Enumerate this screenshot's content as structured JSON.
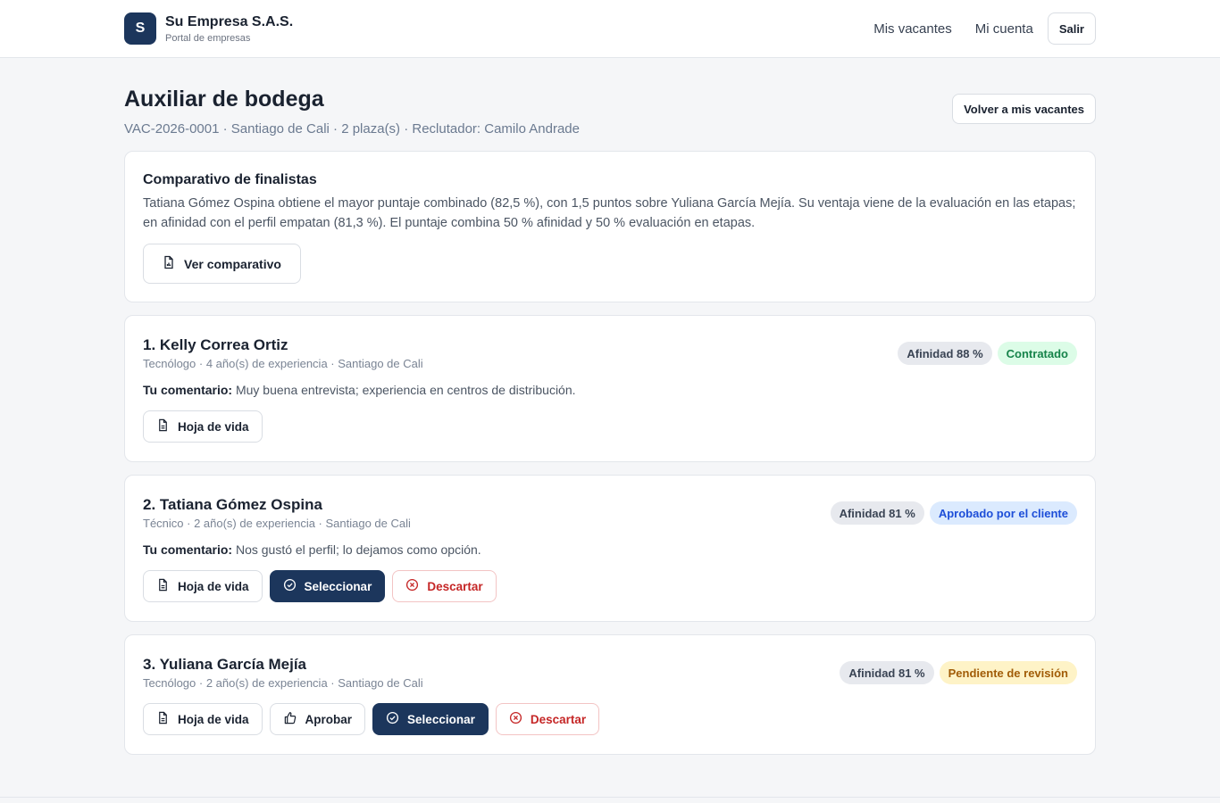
{
  "header": {
    "logo_letter": "S",
    "company": "Su Empresa S.A.S.",
    "subtitle": "Portal de empresas",
    "nav": [
      "Mis vacantes",
      "Mi cuenta"
    ],
    "logout": "Salir"
  },
  "page": {
    "title": "Auxiliar de bodega",
    "meta": "VAC-2026-0001 · Santiago de Cali · 2 plaza(s) · Reclutador: Camilo Andrade",
    "back_button": "Volver a mis vacantes"
  },
  "comparison": {
    "title": "Comparativo de finalistas",
    "body": "Tatiana Gómez Ospina obtiene el mayor puntaje combinado (82,5 %), con 1,5 puntos sobre Yuliana García Mejía. Su ventaja viene de la evaluación en las etapas; en afinidad con el perfil empatan (81,3 %). El puntaje combina 50 % afinidad y 50 % evaluación en etapas.",
    "button": "Ver comparativo"
  },
  "comment_label": "Tu comentario:",
  "candidates": [
    {
      "name": "1. Kelly Correa Ortiz",
      "info": "Tecnólogo · 4 año(s) de experiencia · Santiago de Cali",
      "affinity": "Afinidad 88 %",
      "status": "Contratado",
      "comment": "Muy buena entrevista; experiencia en centros de distribución.",
      "buttons": {
        "cv": "Hoja de vida"
      }
    },
    {
      "name": "2. Tatiana Gómez Ospina",
      "info": "Técnico · 2 año(s) de experiencia · Santiago de Cali",
      "affinity": "Afinidad 81 %",
      "status": "Aprobado por el cliente",
      "comment": "Nos gustó el perfil; lo dejamos como opción.",
      "buttons": {
        "cv": "Hoja de vida",
        "select": "Seleccionar",
        "discard": "Descartar"
      }
    },
    {
      "name": "3. Yuliana García Mejía",
      "info": "Tecnólogo · 2 año(s) de experiencia · Santiago de Cali",
      "affinity": "Afinidad 81 %",
      "status": "Pendiente de revisión",
      "buttons": {
        "cv": "Hoja de vida",
        "approve": "Aprobar",
        "select": "Seleccionar",
        "discard": "Descartar"
      }
    }
  ],
  "colors": {
    "brand": "#1c365c",
    "status_hired": "#16834a",
    "status_approved": "#1d4ed8",
    "status_pending": "#a15c07",
    "danger": "#c52626"
  },
  "icons": [
    "document-icon",
    "check-circle-icon",
    "x-circle-icon",
    "thumbs-up-icon"
  ]
}
